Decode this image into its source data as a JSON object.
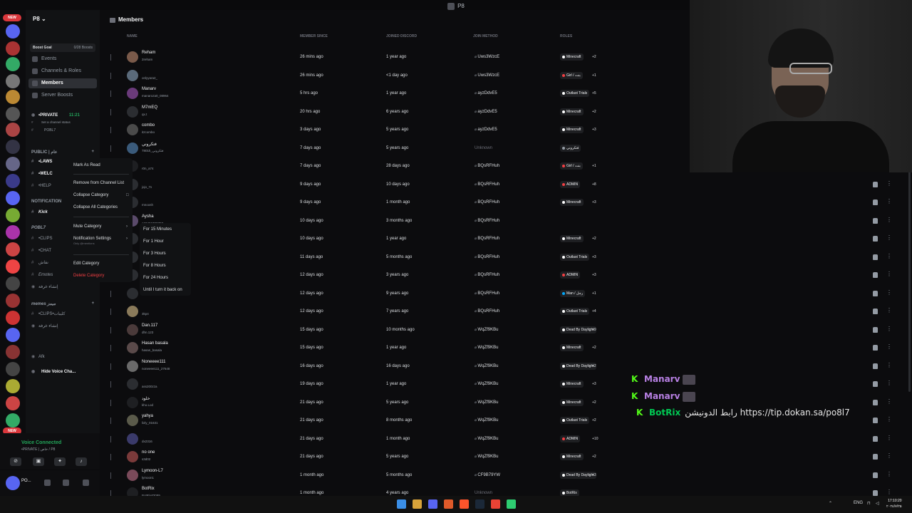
{
  "window_title": "P8",
  "server": {
    "name": "P8",
    "boost_label": "Boost Goal",
    "boost_count": "0/28 Boosts"
  },
  "nav": [
    {
      "label": "Events"
    },
    {
      "label": "Channels & Roles"
    },
    {
      "label": "Members"
    },
    {
      "label": "Server Boosts"
    }
  ],
  "channels": {
    "private": "•PRIVATE",
    "private_time": "11:21",
    "status_hint": "Set a channel status",
    "sub_user": "POBL7",
    "cat_public": "PUBLIC | عام",
    "laws": "•LAWS",
    "welc": "•WELC",
    "help": "•HELP",
    "cat_notif": "NOTIFICATION",
    "kick": "Kick",
    "cat_pobl": "POBL7",
    "clips": "•CLIPS",
    "chat": "•CHAT",
    "ch_arabic": "نقاش",
    "emotes": "Emotes",
    "voice1": "إنشاء غرفة",
    "cat_memes": "memes ميمز",
    "clips2": "•CLIPS•كليبات",
    "voice2": "إنشاء غرفة",
    "afk": "Afk",
    "hide_voice": "Hide Voice Cha..."
  },
  "voice": {
    "status": "Voice Connected",
    "channel": "•PRIVATE | خاص / P8"
  },
  "user": {
    "name": "PO..."
  },
  "header": {
    "title": "Members"
  },
  "columns": {
    "name": "NAME",
    "since": "MEMBER SINCE",
    "joined": "JOINED DISCORD",
    "method": "JOIN METHOD",
    "roles": "ROLES"
  },
  "context_menu": {
    "mark_read": "Mark As Read",
    "remove": "Remove from Channel List",
    "collapse": "Collapse Category",
    "collapse_all": "Collapse All Categories",
    "mute": "Mute Category",
    "notif": "Notification Settings",
    "notif_sub": "Only @mentions",
    "edit": "Edit Category",
    "delete": "Delete Category"
  },
  "mute_menu": [
    "For 15 Minutes",
    "For 1 Hour",
    "For 3 Hours",
    "For 8 Hours",
    "For 24 Hours",
    "Until I turn it back on"
  ],
  "members": [
    {
      "name": "Reham",
      "user": "2reham",
      "since": "26 mins ago",
      "joined": "1 year ago",
      "method": "Uws3WzcE",
      "role": "Minecraft",
      "more": "+2",
      "color": "#ffffff",
      "avatar": "#7a5a4a"
    },
    {
      "name": "",
      "user": "onlyyara2_",
      "since": "26 mins ago",
      "joined": "<1 day ago",
      "method": "Uws3WzcE",
      "role": "Girl / بنت",
      "more": "+1",
      "color": "#f23f43",
      "avatar": "#5a6a7a"
    },
    {
      "name": "Manarv",
      "user": "manaroza0_08964",
      "since": "5 hrs ago",
      "joined": "1 year ago",
      "method": "ayzDdvE5",
      "role": "Outlast Trials",
      "more": "+5",
      "color": "#ffffff",
      "avatar": "#6a3a7a"
    },
    {
      "name": "M7mEQ",
      "user": "qx.t",
      "since": "20 hrs ago",
      "joined": "6 years ago",
      "method": "ayzDdvE5",
      "role": "Minecraft",
      "more": "+2",
      "color": "#ffffff",
      "avatar": "#2b2d31"
    },
    {
      "name": "combo",
      "user": "itzcombo",
      "since": "3 days ago",
      "joined": "5 years ago",
      "method": "ayzDdvE5",
      "role": "Minecraft",
      "more": "+3",
      "color": "#ffffff",
      "avatar": "#4a4a4a"
    },
    {
      "name": "فتكروني",
      "user": "7801k_فتكروني",
      "since": "7 days ago",
      "joined": "5 years ago",
      "method": "Unknown",
      "role": "فتكروني",
      "more": "",
      "color": "#949ba4",
      "avatar": "#3a5a7a"
    },
    {
      "name": "",
      "user": "r0n_a74",
      "since": "7 days ago",
      "joined": "28 days ago",
      "method": "BQsRFHuh",
      "role": "Girl / بنت",
      "more": "+1",
      "color": "#f23f43",
      "avatar": "#1e1f22"
    },
    {
      "name": "",
      "user": "jojo_7x",
      "since": "9 days ago",
      "joined": "10 days ago",
      "method": "BQsRFHuh",
      "role": "ADMIN",
      "more": "+8",
      "color": "#f23f43",
      "avatar": "#2b2d31"
    },
    {
      "name": "",
      "user": "mnoosh",
      "since": "9 days ago",
      "joined": "1 month ago",
      "method": "BQsRFHuh",
      "role": "Minecraft",
      "more": "+3",
      "color": "#ffffff",
      "avatar": "#2b2d31"
    },
    {
      "name": "Aysha",
      "user": "a23456780797",
      "since": "10 days ago",
      "joined": "3 months ago",
      "method": "BQsRFHuh",
      "role": "",
      "more": "",
      "color": "#ffffff",
      "avatar": "#5a4a6a"
    },
    {
      "name": "",
      "user": "",
      "since": "10 days ago",
      "joined": "1 year ago",
      "method": "BQsRFHuh",
      "role": "Minecraft",
      "more": "+2",
      "color": "#ffffff",
      "avatar": "#2b2d31"
    },
    {
      "name": "",
      "user": "",
      "since": "11 days ago",
      "joined": "5 months ago",
      "method": "BQsRFHuh",
      "role": "Outlast Trials",
      "more": "+3",
      "color": "#ffffff",
      "avatar": "#2b2d31"
    },
    {
      "name": "",
      "user": "",
      "since": "12 days ago",
      "joined": "3 years ago",
      "method": "BQsRFHuh",
      "role": "ADMIN",
      "more": "+3",
      "color": "#f23f43",
      "avatar": "#2b2d31"
    },
    {
      "name": "",
      "user": "",
      "since": "12 days ago",
      "joined": "9 years ago",
      "method": "BQsRFHuh",
      "role": "Man / رجل",
      "more": "+1",
      "color": "#00a8fc",
      "avatar": "#2b2d31"
    },
    {
      "name": "",
      "user": "3kp4",
      "since": "12 days ago",
      "joined": "7 years ago",
      "method": "BQsRFHuh",
      "role": "Outlast Trials",
      "more": "+4",
      "color": "#ffffff",
      "avatar": "#8a7a5a"
    },
    {
      "name": "Dan.117",
      "user": "dhn.123",
      "since": "15 days ago",
      "joined": "10 months ago",
      "method": "WqZf9KBu",
      "role": "Dead By Daylight",
      "more": "+9",
      "color": "#ffffff",
      "avatar": "#4a3a3a"
    },
    {
      "name": "Hasan basala",
      "user": "hasan_basala",
      "since": "15 days ago",
      "joined": "1 year ago",
      "method": "WqZf9KBu",
      "role": "Minecraft",
      "more": "+2",
      "color": "#ffffff",
      "avatar": "#5a4a4a"
    },
    {
      "name": "Noneeee111",
      "user": "noneeee111_27648",
      "since": "16 days ago",
      "joined": "16 days ago",
      "method": "WqZf9KBu",
      "role": "Dead By Daylight",
      "more": "+2",
      "color": "#ffffff",
      "avatar": "#6a6a6a"
    },
    {
      "name": "",
      "user": "ass200zza",
      "since": "19 days ago",
      "joined": "1 year ago",
      "method": "WqZf9KBu",
      "role": "Minecraft",
      "more": "+3",
      "color": "#ffffff",
      "avatar": "#2b2d31"
    },
    {
      "name": "خلود",
      "user": "kho.Lod",
      "since": "21 days ago",
      "joined": "5 years ago",
      "method": "WqZf9KBu",
      "role": "Minecraft",
      "more": "+2",
      "color": "#ffffff",
      "avatar": "#1e1f22"
    },
    {
      "name": "yahya",
      "user": "lixly_01631",
      "since": "21 days ago",
      "joined": "8 months ago",
      "method": "WqZf9KBu",
      "role": "Outlast Trials",
      "more": "+2",
      "color": "#ffffff",
      "avatar": "#5a5a4a"
    },
    {
      "name": "",
      "user": "dx2316",
      "since": "21 days ago",
      "joined": "1 month ago",
      "method": "WqZf9KBu",
      "role": "ADMIN",
      "more": "+10",
      "color": "#f23f43",
      "avatar": "#3a3a6a"
    },
    {
      "name": "no one",
      "user": "s3d02",
      "since": "21 days ago",
      "joined": "5 years ago",
      "method": "WqZf9KBu",
      "role": "Minecraft",
      "more": "+2",
      "color": "#ffffff",
      "avatar": "#7a3a3a"
    },
    {
      "name": "Lymoon-L7",
      "user": "lymoon1",
      "since": "1 month ago",
      "joined": "5 months ago",
      "method": "CF9B79YW",
      "role": "Dead By Daylight",
      "more": "+3",
      "color": "#ffffff",
      "avatar": "#7a4a5a"
    },
    {
      "name": "BotRix",
      "user": "BotRix#3089",
      "since": "1 month ago",
      "joined": "4 years ago",
      "method": "Unknown",
      "role": "BotRix",
      "more": "",
      "color": "#ffffff",
      "avatar": "#1e1f22"
    }
  ],
  "chat": [
    {
      "name": "Manarv",
      "message": ""
    },
    {
      "name": "Manarv",
      "message": ""
    },
    {
      "name": "BotRix",
      "message": "رابط الدونيشن https://tip.dokan.sa/po8l7"
    }
  ],
  "tray": {
    "lang": "ENG",
    "time": "17:10:20",
    "date": "٢٠٢٤/٧/٢٥"
  }
}
